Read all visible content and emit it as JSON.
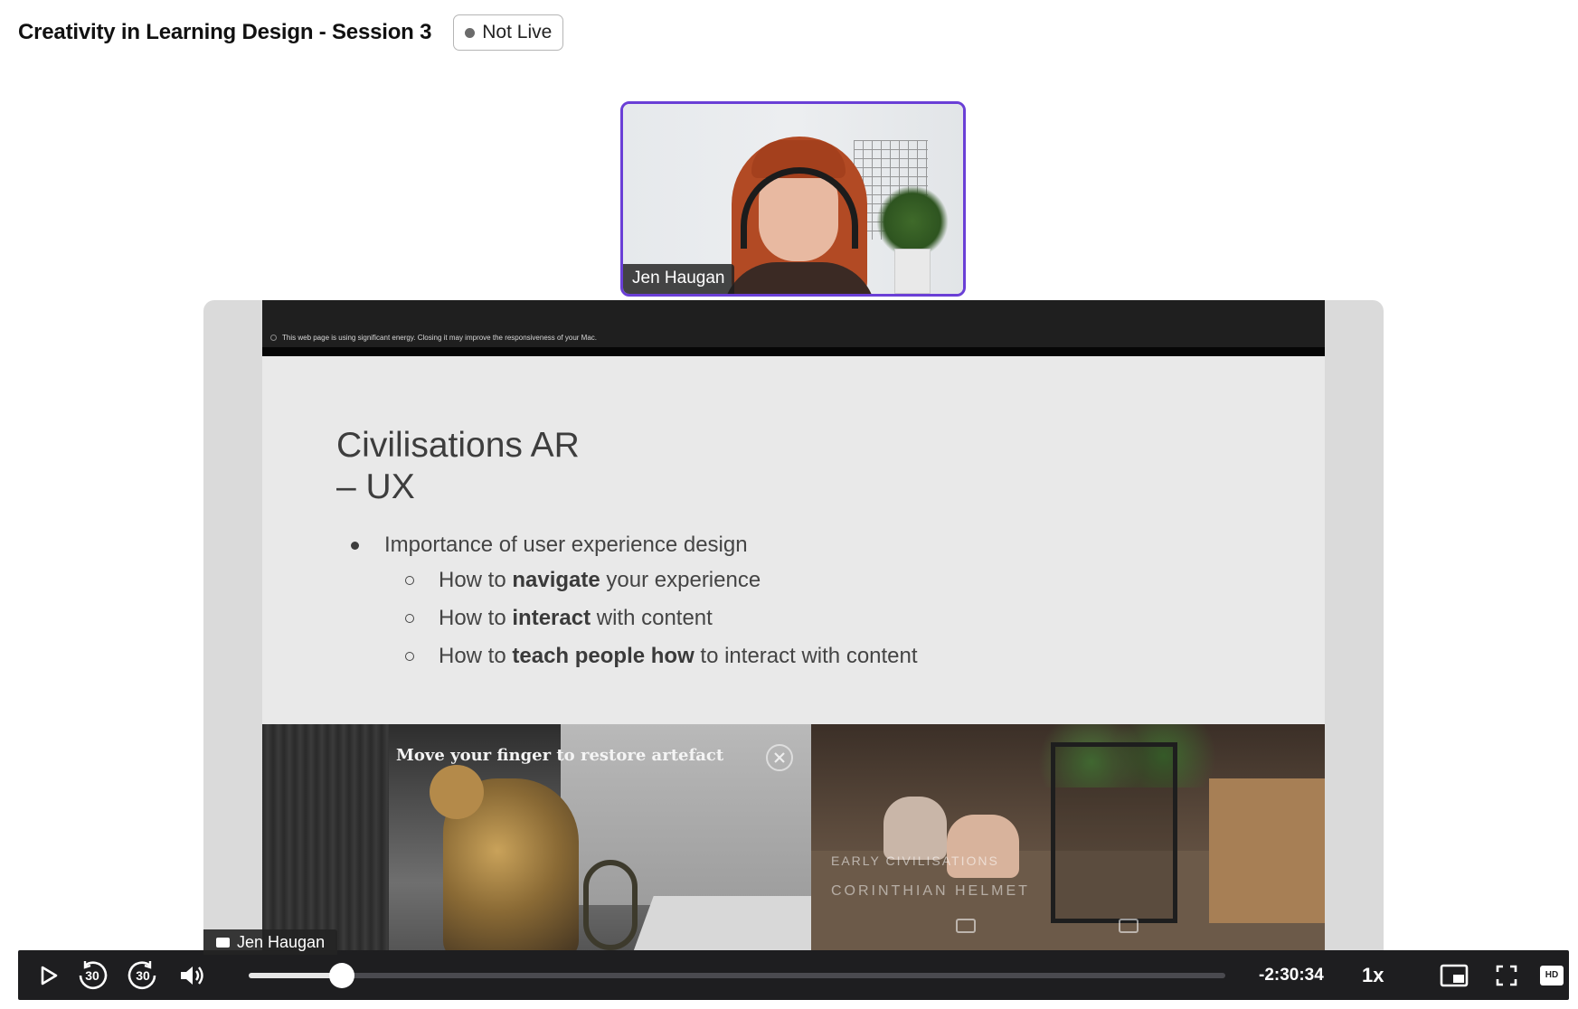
{
  "header": {
    "title": "Creativity in Learning Design - Session 3",
    "status_badge": "Not Live"
  },
  "camera": {
    "participant_name": "Jen Haugan",
    "accent_color": "#6a3fd6"
  },
  "screen_share": {
    "presenter_label": "Jen Haugan",
    "browser_notice": "This web page is using significant energy. Closing it may improve the responsiveness of your Mac.",
    "slide": {
      "title_line1": "Civilisations AR",
      "title_line2": "– UX",
      "bullet": "Importance of user experience design",
      "sub_bullets": [
        {
          "before": "How to ",
          "bold": "navigate",
          "after": " your experience"
        },
        {
          "before": "How to ",
          "bold": "interact",
          "after": " with content"
        },
        {
          "before": "How to ",
          "bold": "teach people how",
          "after": " to interact with content"
        }
      ],
      "image_left_overlay": "Move your finger to restore artefact",
      "image_right_label_1": "EARLY CIVILISATIONS",
      "image_right_label_2": "CORINTHIAN HELMET"
    }
  },
  "player": {
    "play_icon": "play-icon",
    "skip_back_seconds": "30",
    "skip_forward_seconds": "30",
    "volume_icon": "volume-icon",
    "progress_fraction": 0.095,
    "time_remaining": "-2:30:34",
    "playback_speed": "1x",
    "pip_icon": "picture-in-picture-icon",
    "fullscreen_icon": "fullscreen-icon",
    "quality_label": "HD"
  }
}
